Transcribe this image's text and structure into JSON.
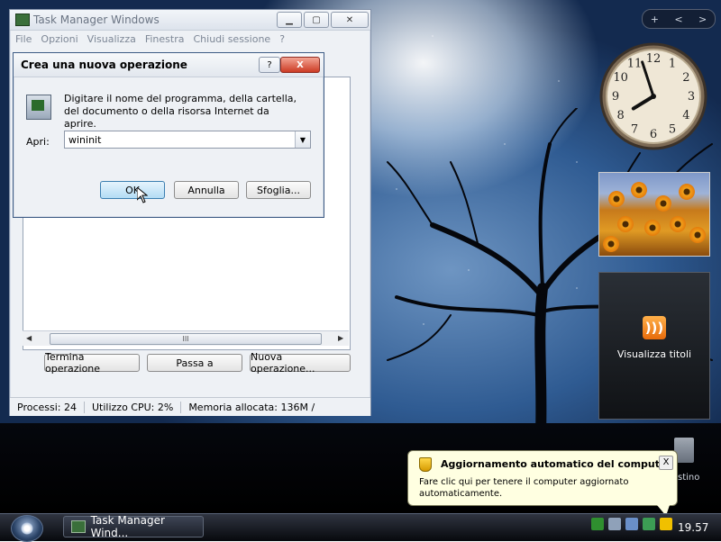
{
  "task_manager": {
    "title": "Task Manager Windows",
    "menu": [
      "File",
      "Opzioni",
      "Visualizza",
      "Finestra",
      "Chiudi sessione",
      "?"
    ],
    "buttons": {
      "end_task": "Termina operazione",
      "switch_to": "Passa a",
      "new_task": "Nuova operazione..."
    },
    "status": {
      "processes": "Processi: 24",
      "cpu": "Utilizzo CPU: 2%",
      "memory": "Memoria allocata: 136M /"
    },
    "scroll_thumb": "III"
  },
  "run_dialog": {
    "title": "Crea una nuova operazione",
    "help": "?",
    "close": "X",
    "prompt": "Digitare il nome del programma, della cartella, del documento o della risorsa Internet da aprire.",
    "open_label": "Apri:",
    "open_value": "wininit",
    "ok": "OK",
    "cancel": "Annulla",
    "browse": "Sfoglia..."
  },
  "sidebar": {
    "nav": [
      "+",
      "<",
      ">"
    ],
    "feed_label": "Visualizza titoli",
    "feed_icon": "rss-icon"
  },
  "desktop": {
    "recycle_label": "stino"
  },
  "balloon": {
    "title": "Aggiornamento automatico del computer",
    "text": "Fare clic qui per tenere il computer aggiornato automaticamente.",
    "close": "X"
  },
  "taskbar": {
    "task_label": "Task Manager Wind...",
    "time": "19.57"
  },
  "clock": {
    "hour": 7,
    "minute": 57,
    "numbers": [
      "12",
      "1",
      "2",
      "3",
      "4",
      "5",
      "6",
      "7",
      "8",
      "9",
      "10",
      "11"
    ]
  }
}
